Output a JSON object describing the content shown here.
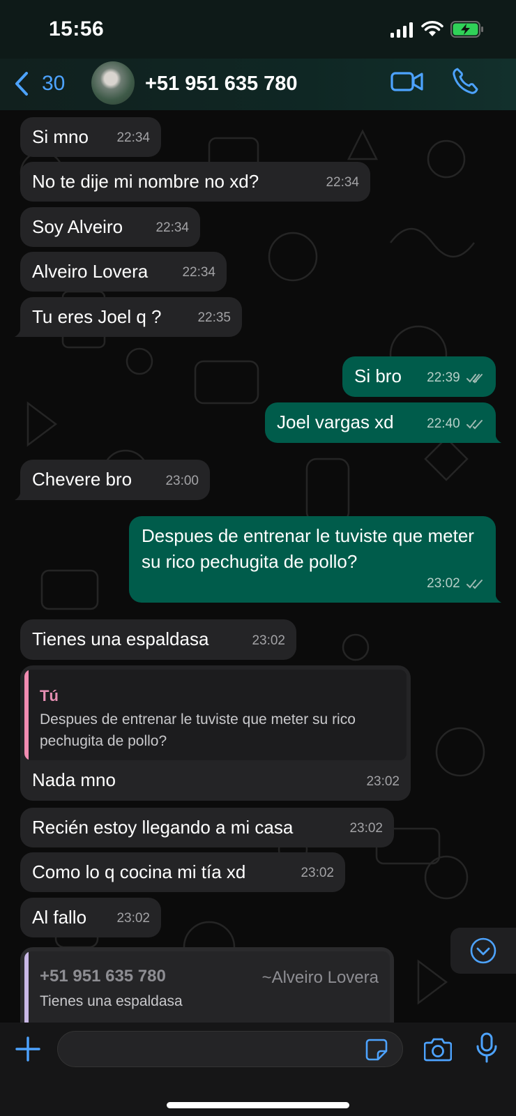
{
  "status_bar": {
    "time": "15:56"
  },
  "header": {
    "back_count": "30",
    "contact": "+51 951 635 780"
  },
  "colors": {
    "accent_blue": "#4da3ff",
    "incoming_bubble": "#242426",
    "outgoing_bubble": "#005c4b",
    "quote_bar_own": "#f28cb1",
    "quote_author_own": "#e68fb3",
    "quote_bar_contact": "#c9b8e6",
    "quote_author_contact": "#8e8e93"
  },
  "icons": {
    "back": "chevron-left-icon",
    "video": "video-camera-icon",
    "call": "phone-icon",
    "scroll": "chevron-down-circle-icon",
    "attach": "plus-icon",
    "sticker": "sticker-icon",
    "camera": "camera-icon",
    "mic": "microphone-icon",
    "read": "double-check-icon"
  },
  "messages": [
    {
      "direction": "in",
      "text": "Si mno",
      "time": "22:34"
    },
    {
      "direction": "in",
      "text": "No te dije mi nombre no xd?",
      "time": "22:34"
    },
    {
      "direction": "in",
      "text": "Soy Alveiro",
      "time": "22:34"
    },
    {
      "direction": "in",
      "text": "Alveiro Lovera",
      "time": "22:34"
    },
    {
      "direction": "in",
      "text": "Tu eres Joel q ?",
      "time": "22:35"
    },
    {
      "direction": "out",
      "text": "Si bro",
      "time": "22:39"
    },
    {
      "direction": "out",
      "text": "Joel vargas xd",
      "time": "22:40"
    },
    {
      "direction": "in",
      "text": "Chevere bro",
      "time": "23:00"
    },
    {
      "direction": "out",
      "text": "Despues de entrenar le tuviste que meter su rico pechugita de pollo?",
      "time": "23:02"
    },
    {
      "direction": "in",
      "text": "Tienes una espaldasa",
      "time": "23:02"
    },
    {
      "direction": "in",
      "text": "Nada mno",
      "time": "23:02",
      "quote": {
        "author": "Tú",
        "text": "Despues de entrenar le tuviste que meter su rico pechugita de pollo?"
      }
    },
    {
      "direction": "in",
      "text": "Recién estoy llegando a mi casa",
      "time": "23:02"
    },
    {
      "direction": "in",
      "text": "Como lo q cocina mi tía xd",
      "time": "23:02"
    },
    {
      "direction": "in",
      "text": "Al fallo",
      "time": "23:02"
    },
    {
      "direction": "out",
      "text": "",
      "quote": {
        "author": "+51 951 635 780",
        "alias": "~Alveiro Lovera",
        "text": "Tienes una espaldasa"
      }
    }
  ],
  "composer": {
    "value": "",
    "placeholder": ""
  }
}
